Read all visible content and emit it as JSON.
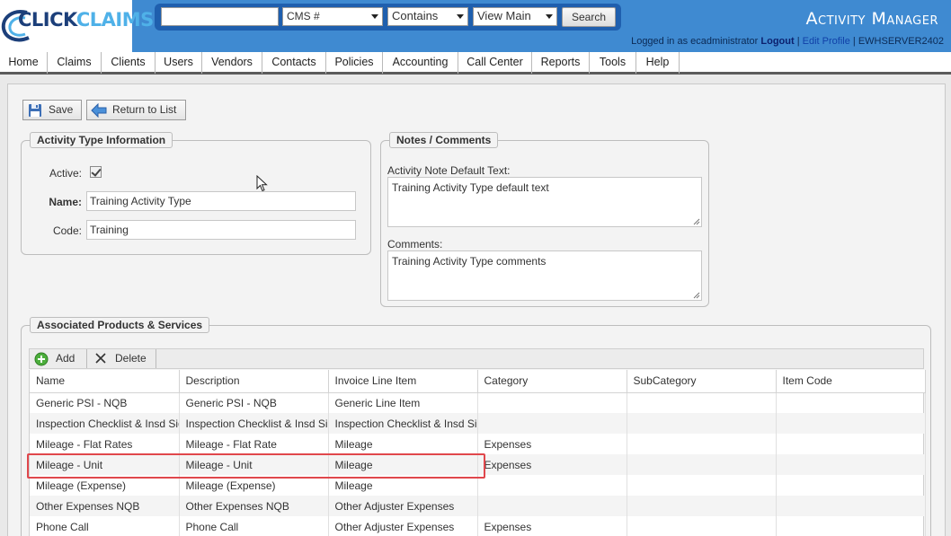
{
  "header": {
    "logo_part1": "CLICK",
    "logo_part2": "CLAIMS",
    "app_title": "Activity Manager",
    "search": {
      "query_value": "",
      "field_select": "CMS #",
      "operator_select": "Contains",
      "view_select": "View Main",
      "search_button": "Search"
    },
    "login": {
      "prefix": "Logged in as ecadministrator",
      "logout": "Logout",
      "sep1": "|",
      "edit_profile": "Edit Profile",
      "sep2": "|",
      "server": "EWHSERVER2402"
    }
  },
  "menu": {
    "items": [
      "Home",
      "Claims",
      "Clients",
      "Users",
      "Vendors",
      "Contacts",
      "Policies",
      "Accounting",
      "Call Center",
      "Reports",
      "Tools",
      "Help"
    ]
  },
  "toolbar": {
    "save_label": "Save",
    "return_label": "Return to List"
  },
  "activity_type": {
    "legend": "Activity Type Information",
    "active_label": "Active:",
    "active_checked": true,
    "name_label": "Name:",
    "name_value": "Training Activity Type",
    "code_label": "Code:",
    "code_value": "Training"
  },
  "notes": {
    "legend": "Notes / Comments",
    "default_text_label": "Activity Note Default Text:",
    "default_text_value": "Training Activity Type default text",
    "comments_label": "Comments:",
    "comments_value": "Training Activity Type comments"
  },
  "products": {
    "legend": "Associated Products & Services",
    "add_label": "Add",
    "delete_label": "Delete",
    "columns": [
      "Name",
      "Description",
      "Invoice Line Item",
      "Category",
      "SubCategory",
      "Item Code"
    ],
    "rows": [
      [
        "Generic PSI - NQB",
        "Generic PSI - NQB",
        "Generic Line Item",
        "",
        "",
        ""
      ],
      [
        "Inspection Checklist & Insd Sig",
        "Inspection Checklist & Insd Sig",
        "Inspection Checklist & Insd Sig",
        "",
        "",
        ""
      ],
      [
        "Mileage - Flat Rates",
        "Mileage - Flat Rate",
        "Mileage",
        "Expenses",
        "",
        ""
      ],
      [
        "Mileage - Unit",
        "Mileage - Unit",
        "Mileage",
        "Expenses",
        "",
        ""
      ],
      [
        "Mileage (Expense)",
        "Mileage (Expense)",
        "Mileage",
        "",
        "",
        ""
      ],
      [
        "Other Expenses NQB",
        "Other Expenses NQB",
        "Other Adjuster Expenses",
        "",
        "",
        ""
      ],
      [
        "Phone Call",
        "Phone Call",
        "Other Adjuster Expenses",
        "Expenses",
        "",
        ""
      ]
    ],
    "highlighted_row": "Mileage - Unit"
  },
  "colors": {
    "header_blue": "#3f8ad1",
    "search_bar_blue": "#1f5fae",
    "highlight_red": "#e0474c"
  }
}
